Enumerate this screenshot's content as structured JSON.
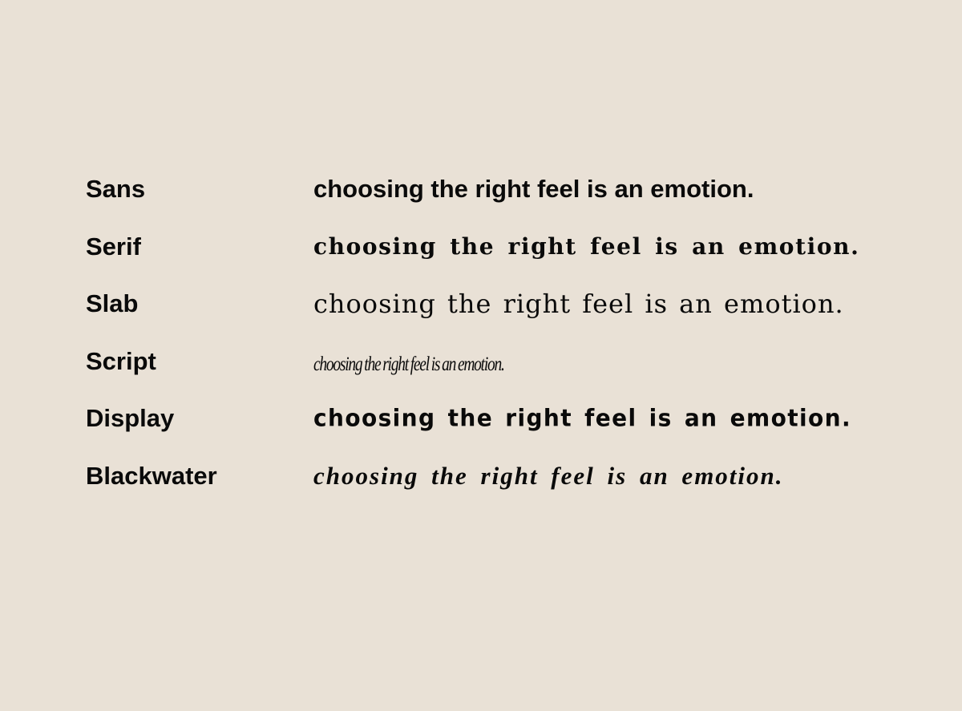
{
  "rows": [
    {
      "label": "Sans",
      "sample": "choosing the right feel is an emotion."
    },
    {
      "label": "Serif",
      "sample": "choosing the right feel is an emotion."
    },
    {
      "label": "Slab",
      "sample": "choosing the right feel is an emotion."
    },
    {
      "label": "Script",
      "sample": "choosing the right feel is an emotion."
    },
    {
      "label": "Display",
      "sample": "choosing the right feel is an emotion."
    },
    {
      "label": "Blackwater",
      "sample": "choosing the right feel is an emotion."
    }
  ],
  "colors": {
    "background": "#e9e1d6",
    "text": "#0a0a0a"
  }
}
